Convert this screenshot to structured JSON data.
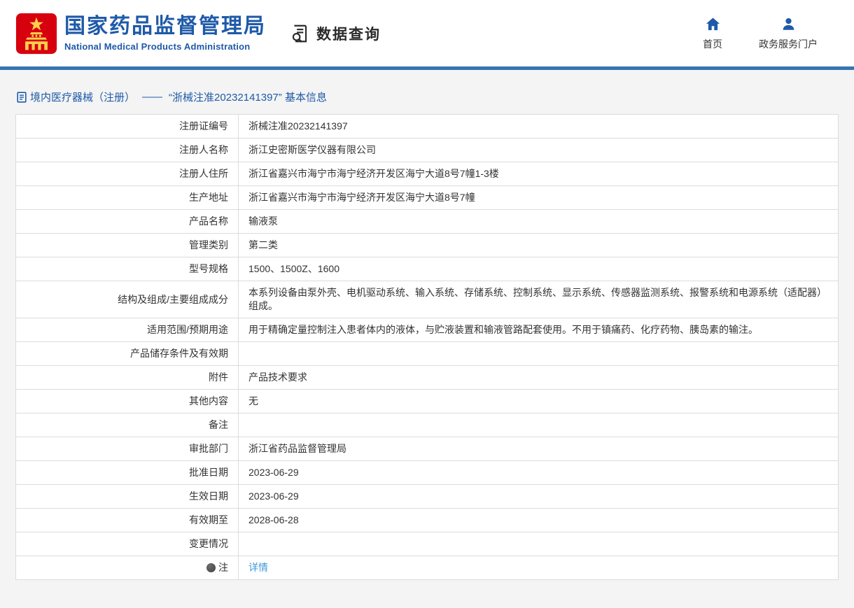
{
  "colors": {
    "brand_blue": "#1e5aa8",
    "bar_blue": "#3674b5",
    "link_blue": "#3a9ad9",
    "emblem_red": "#d7000f",
    "emblem_gold": "#ffd04c",
    "page_bg": "#f4f4f4",
    "table_border": "#dcdcdc"
  },
  "header": {
    "org_name_cn": "国家药品监督管理局",
    "org_name_en": "National Medical Products Administration",
    "section_title": "数据查询",
    "nav": [
      {
        "label": "首页",
        "icon": "home-icon"
      },
      {
        "label": "政务服务门户",
        "icon": "user-icon"
      }
    ]
  },
  "breadcrumb": {
    "category": "境内医疗器械（注册）",
    "separator": "——",
    "title": "“浙械注准20232141397” 基本信息"
  },
  "table": {
    "rows": [
      {
        "label": "注册证编号",
        "value": "浙械注准20232141397"
      },
      {
        "label": "注册人名称",
        "value": "浙江史密斯医学仪器有限公司"
      },
      {
        "label": "注册人住所",
        "value": "浙江省嘉兴市海宁市海宁经济开发区海宁大道8号7幢1-3楼"
      },
      {
        "label": "生产地址",
        "value": "浙江省嘉兴市海宁市海宁经济开发区海宁大道8号7幢"
      },
      {
        "label": "产品名称",
        "value": "输液泵"
      },
      {
        "label": "管理类别",
        "value": "第二类"
      },
      {
        "label": "型号规格",
        "value": "1500、1500Z、1600"
      },
      {
        "label": "结构及组成/主要组成成分",
        "value": "本系列设备由泵外壳、电机驱动系统、输入系统、存储系统、控制系统、显示系统、传感器监测系统、报警系统和电源系统（适配器）组成。"
      },
      {
        "label": "适用范围/预期用途",
        "value": "用于精确定量控制注入患者体内的液体，与贮液装置和输液管路配套使用。不用于镇痛药、化疗药物、胰岛素的输注。"
      },
      {
        "label": "产品储存条件及有效期",
        "value": ""
      },
      {
        "label": "附件",
        "value": "产品技术要求"
      },
      {
        "label": "其他内容",
        "value": "无"
      },
      {
        "label": "备注",
        "value": ""
      },
      {
        "label": "审批部门",
        "value": "浙江省药品监督管理局"
      },
      {
        "label": "批准日期",
        "value": "2023-06-29"
      },
      {
        "label": "生效日期",
        "value": "2023-06-29"
      },
      {
        "label": "有效期至",
        "value": "2028-06-28"
      },
      {
        "label": "变更情况",
        "value": ""
      },
      {
        "label": "注",
        "label_icon": "note-icon",
        "value": "详情",
        "link": true
      }
    ]
  }
}
